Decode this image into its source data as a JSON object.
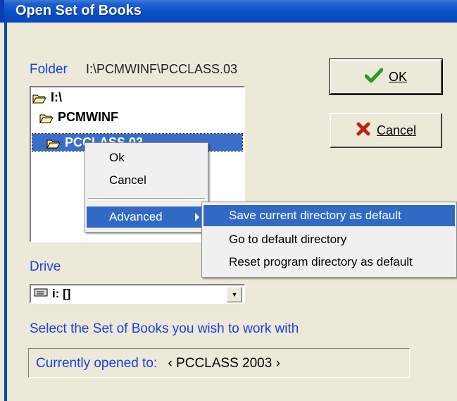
{
  "window": {
    "title": "Open Set of Books"
  },
  "folder": {
    "label": "Folder",
    "path": "I:\\PCMWINF\\PCCLASS.03"
  },
  "tree": {
    "items": [
      {
        "label": "I:\\",
        "icon": "open-folder-icon"
      },
      {
        "label": "PCMWINF",
        "icon": "open-folder-icon"
      },
      {
        "label": "PCCLASS.03",
        "icon": "open-folder-icon",
        "selected": true
      }
    ]
  },
  "buttons": {
    "ok": "OK",
    "ok_icon": "checkmark-icon",
    "cancel": "Cancel",
    "cancel_icon": "x-icon"
  },
  "drive": {
    "label": "Drive",
    "value": "i: []",
    "icon": "drive-icon"
  },
  "instruction": "Select the Set of Books you wish to work with",
  "status": {
    "label": "Currently opened to:",
    "value": "‹ PCCLASS 2003 ›"
  },
  "context_menu": {
    "items": [
      "Ok",
      "Cancel"
    ],
    "advanced": "Advanced"
  },
  "submenu": {
    "items": [
      "Save current directory as default",
      "Go to default directory",
      "Reset program directory as default"
    ]
  },
  "colors": {
    "accent": "#1a3fe0",
    "titlebar": "#0a4fc8",
    "highlight": "#316ac5"
  }
}
